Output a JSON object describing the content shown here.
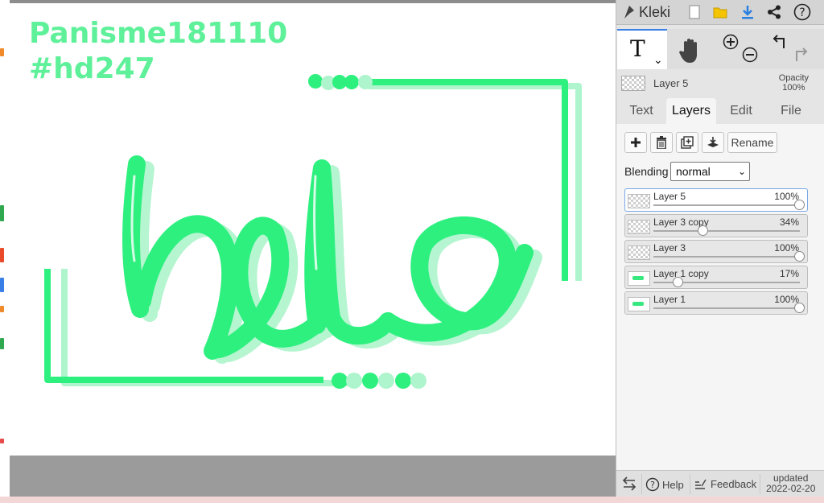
{
  "canvas": {
    "watermark_line1": "Panisme181110",
    "watermark_line2": "#hd247",
    "lettering": "helo"
  },
  "app": {
    "name": "Kleki"
  },
  "layer_info": {
    "current_layer": "Layer 5",
    "opacity_label": "Opacity",
    "opacity_value": "100%"
  },
  "tabs": [
    {
      "label": "Text"
    },
    {
      "label": "Layers"
    },
    {
      "label": "Edit"
    },
    {
      "label": "File"
    }
  ],
  "layers_panel": {
    "rename_label": "Rename",
    "blending_label": "Blending",
    "blending_value": "normal",
    "layers": [
      {
        "name": "Layer 5",
        "opacity": "100%",
        "value": 1.0,
        "active": true,
        "thumb": "empty"
      },
      {
        "name": "Layer 3 copy",
        "opacity": "34%",
        "value": 0.34,
        "active": false,
        "thumb": "empty"
      },
      {
        "name": "Layer 3",
        "opacity": "100%",
        "value": 1.0,
        "active": false,
        "thumb": "empty"
      },
      {
        "name": "Layer 1 copy",
        "opacity": "17%",
        "value": 0.17,
        "active": false,
        "thumb": "art"
      },
      {
        "name": "Layer 1",
        "opacity": "100%",
        "value": 1.0,
        "active": false,
        "thumb": "art"
      }
    ]
  },
  "footer": {
    "help_label": "Help",
    "feedback_label": "Feedback",
    "updated_label": "updated",
    "updated_date": "2022-02-20"
  },
  "colors": {
    "accent_blue": "#3b80e6",
    "art_green": "#2ef07f",
    "art_green_light": "#aef4cc"
  }
}
